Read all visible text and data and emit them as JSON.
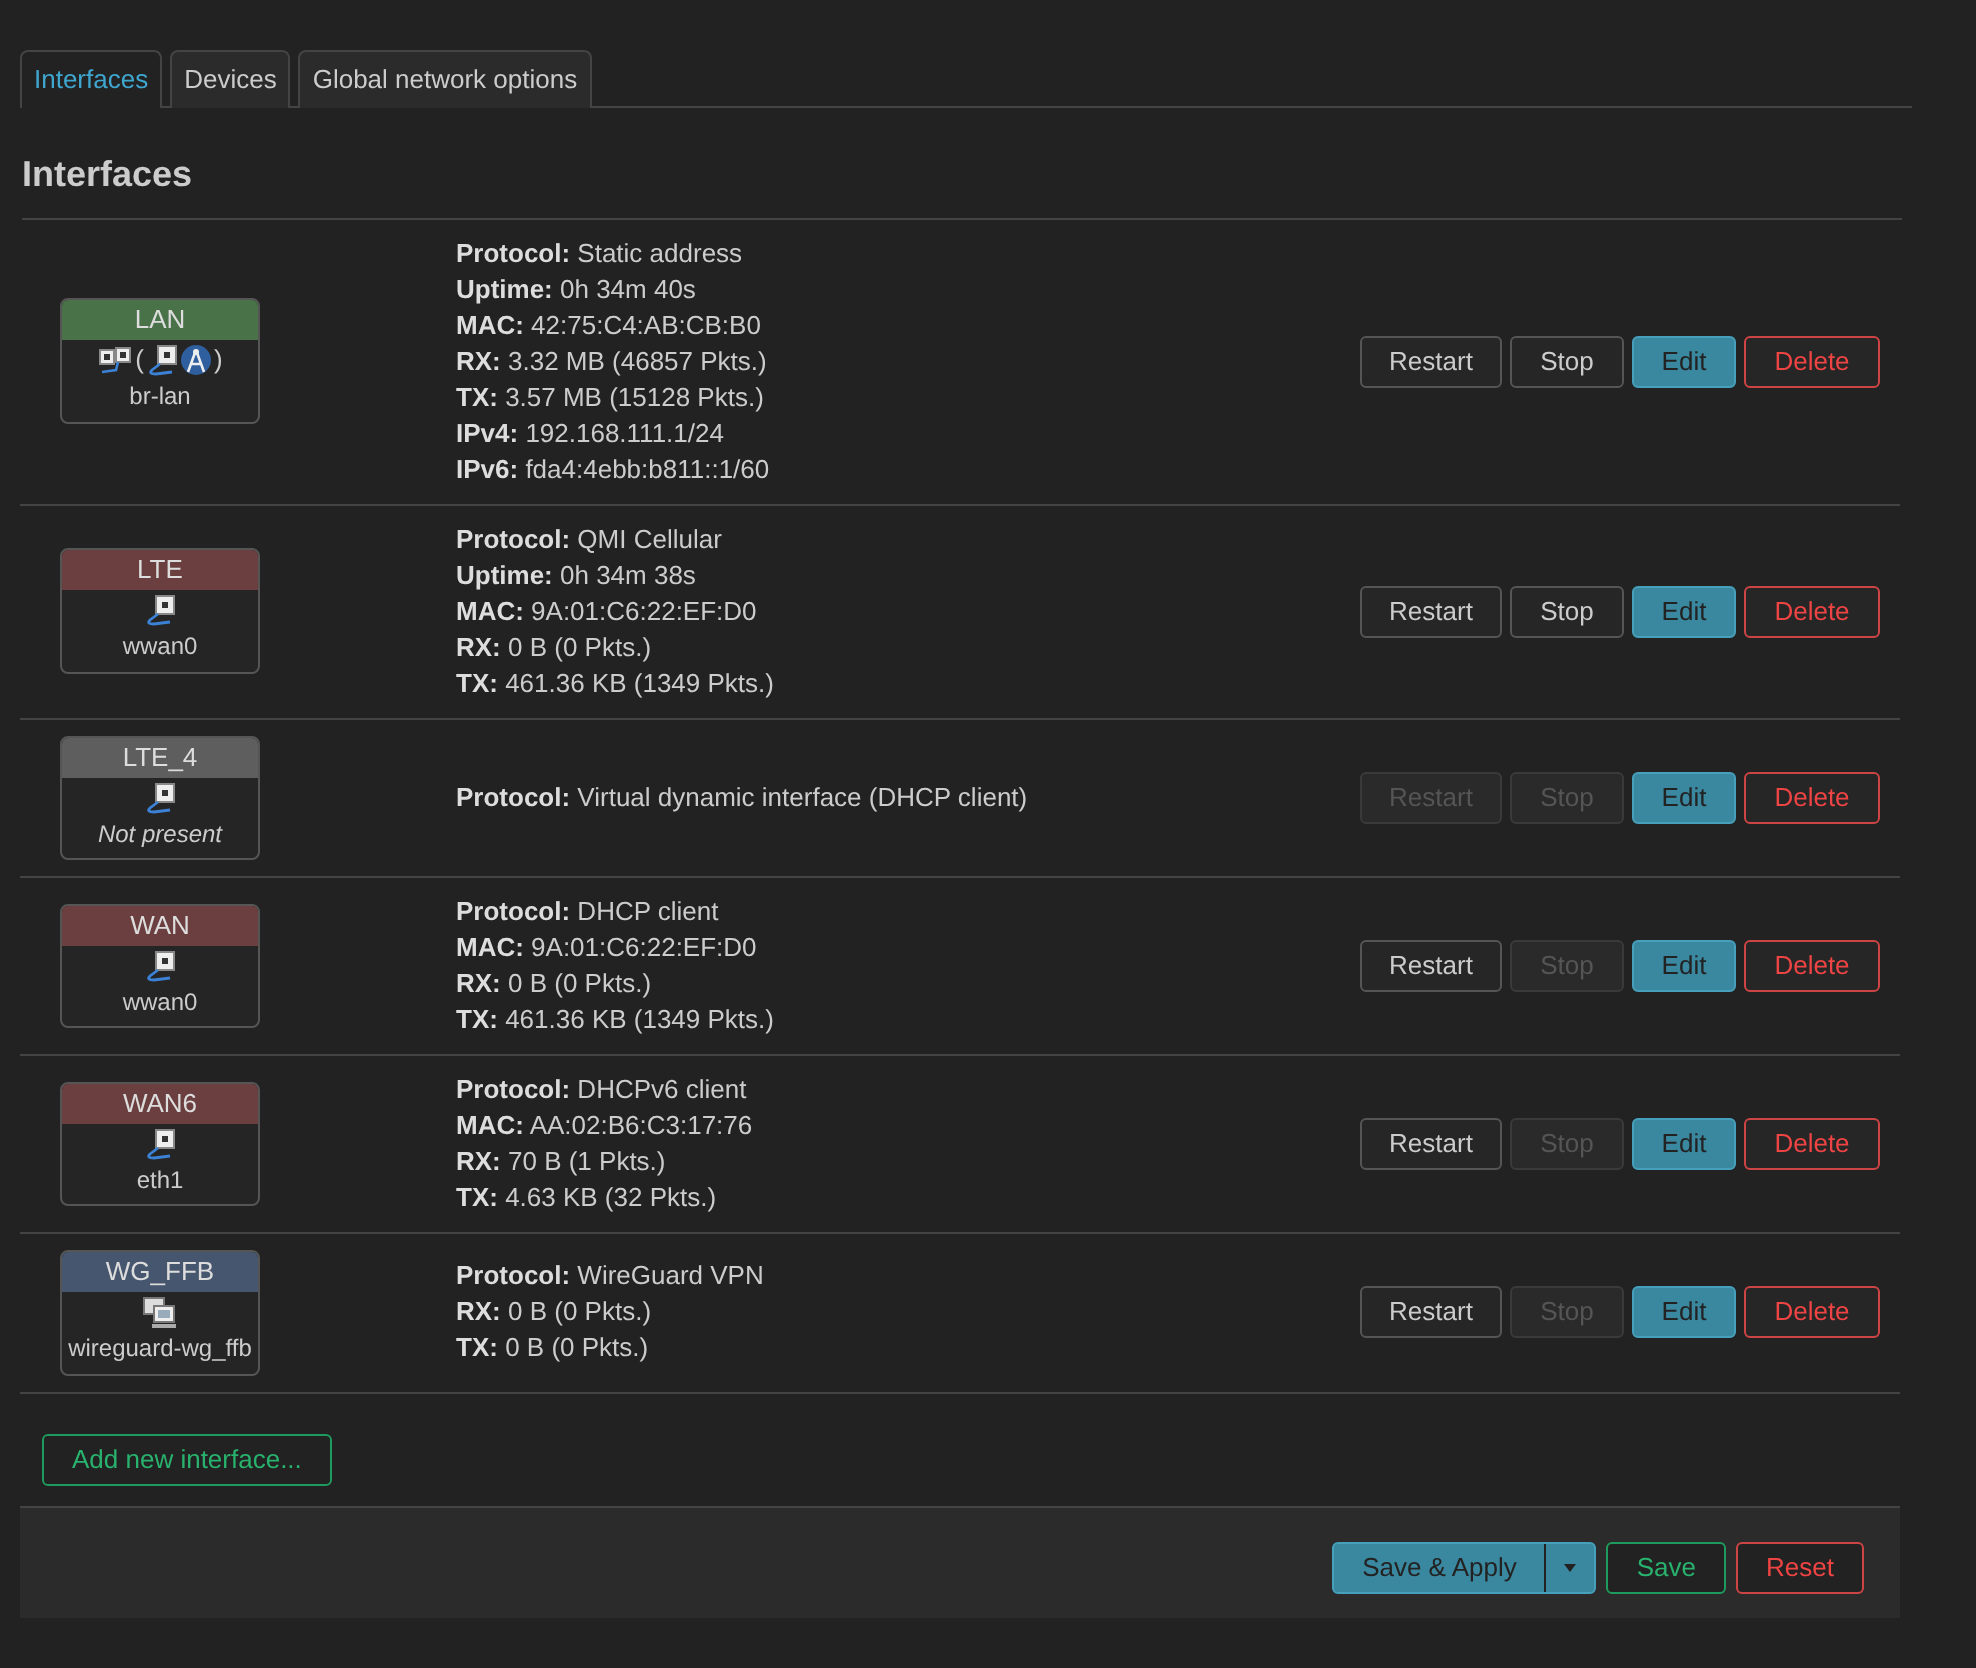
{
  "tabs": [
    {
      "label": "Interfaces",
      "selected": true
    },
    {
      "label": "Devices",
      "selected": false
    },
    {
      "label": "Global network options",
      "selected": false
    }
  ],
  "section_title": "Interfaces",
  "interfaces": [
    {
      "name": "LAN",
      "color": "#4a7249",
      "icons": {
        "kind": "bridge",
        "open": "(",
        "close": ")",
        "members": [
          {
            "kind": "ethernet"
          },
          {
            "kind": "wifi"
          }
        ]
      },
      "device": "br-lan",
      "present": true,
      "details": [
        "**Protocol:** Static address",
        "**Uptime:** 0h 34m 40s",
        "**MAC:** 42:75:C4:AB:CB:B0",
        "**RX:** 3.32 MB (46857 Pkts.)",
        "**TX:** 3.57 MB (15128 Pkts.)",
        "**IPv4:** 192.168.111.1/24",
        "**IPv6:** fda4:4ebb:b811::1/60"
      ],
      "buttons": [
        {
          "label": "Restart",
          "kind": "default",
          "disabled": false
        },
        {
          "label": "Stop",
          "kind": "default",
          "disabled": false
        },
        {
          "label": "Edit",
          "kind": "primary",
          "disabled": false
        },
        {
          "label": "Delete",
          "kind": "danger",
          "disabled": false
        }
      ]
    },
    {
      "name": "LTE",
      "color": "#6b3f3f",
      "icons": {
        "kind": "ethernet"
      },
      "device": "wwan0",
      "present": true,
      "details": [
        "**Protocol:** QMI Cellular",
        "**Uptime:** 0h 34m 38s",
        "**MAC:** 9A:01:C6:22:EF:D0",
        "**RX:** 0 B (0 Pkts.)",
        "**TX:** 461.36 KB (1349 Pkts.)"
      ],
      "buttons": [
        {
          "label": "Restart",
          "kind": "default",
          "disabled": false
        },
        {
          "label": "Stop",
          "kind": "default",
          "disabled": false
        },
        {
          "label": "Edit",
          "kind": "primary",
          "disabled": false
        },
        {
          "label": "Delete",
          "kind": "danger",
          "disabled": false
        }
      ]
    },
    {
      "name": "LTE_4",
      "color": "#5e5e5e",
      "icons": {
        "kind": "ethernet"
      },
      "device": "Not present",
      "present": false,
      "details": [
        "**Protocol:** Virtual dynamic interface (DHCP client)"
      ],
      "buttons": [
        {
          "label": "Restart",
          "kind": "default",
          "disabled": true
        },
        {
          "label": "Stop",
          "kind": "default",
          "disabled": true
        },
        {
          "label": "Edit",
          "kind": "primary",
          "disabled": false
        },
        {
          "label": "Delete",
          "kind": "danger",
          "disabled": false
        }
      ]
    },
    {
      "name": "WAN",
      "color": "#6b3f3f",
      "icons": {
        "kind": "ethernet"
      },
      "device": "wwan0",
      "present": true,
      "details": [
        "**Protocol:** DHCP client",
        "**MAC:** 9A:01:C6:22:EF:D0",
        "**RX:** 0 B (0 Pkts.)",
        "**TX:** 461.36 KB (1349 Pkts.)"
      ],
      "buttons": [
        {
          "label": "Restart",
          "kind": "default",
          "disabled": false
        },
        {
          "label": "Stop",
          "kind": "default",
          "disabled": true
        },
        {
          "label": "Edit",
          "kind": "primary",
          "disabled": false
        },
        {
          "label": "Delete",
          "kind": "danger",
          "disabled": false
        }
      ]
    },
    {
      "name": "WAN6",
      "color": "#6b3f3f",
      "icons": {
        "kind": "ethernet"
      },
      "device": "eth1",
      "present": true,
      "details": [
        "**Protocol:** DHCPv6 client",
        "**MAC:** AA:02:B6:C3:17:76",
        "**RX:** 70 B (1 Pkts.)",
        "**TX:** 4.63 KB (32 Pkts.)"
      ],
      "buttons": [
        {
          "label": "Restart",
          "kind": "default",
          "disabled": false
        },
        {
          "label": "Stop",
          "kind": "default",
          "disabled": true
        },
        {
          "label": "Edit",
          "kind": "primary",
          "disabled": false
        },
        {
          "label": "Delete",
          "kind": "danger",
          "disabled": false
        }
      ]
    },
    {
      "name": "WG_FFB",
      "color": "#46566e",
      "icons": {
        "kind": "tunnel"
      },
      "device": "wireguard-wg_ffb",
      "present": true,
      "details": [
        "**Protocol:** WireGuard VPN",
        "**RX:** 0 B (0 Pkts.)",
        "**TX:** 0 B (0 Pkts.)"
      ],
      "buttons": [
        {
          "label": "Restart",
          "kind": "default",
          "disabled": false
        },
        {
          "label": "Stop",
          "kind": "default",
          "disabled": true
        },
        {
          "label": "Edit",
          "kind": "primary",
          "disabled": false
        },
        {
          "label": "Delete",
          "kind": "danger",
          "disabled": false
        }
      ]
    }
  ],
  "add_button": "Add new interface...",
  "footer": {
    "save_apply": "Save & Apply",
    "save": "Save",
    "reset": "Reset"
  }
}
